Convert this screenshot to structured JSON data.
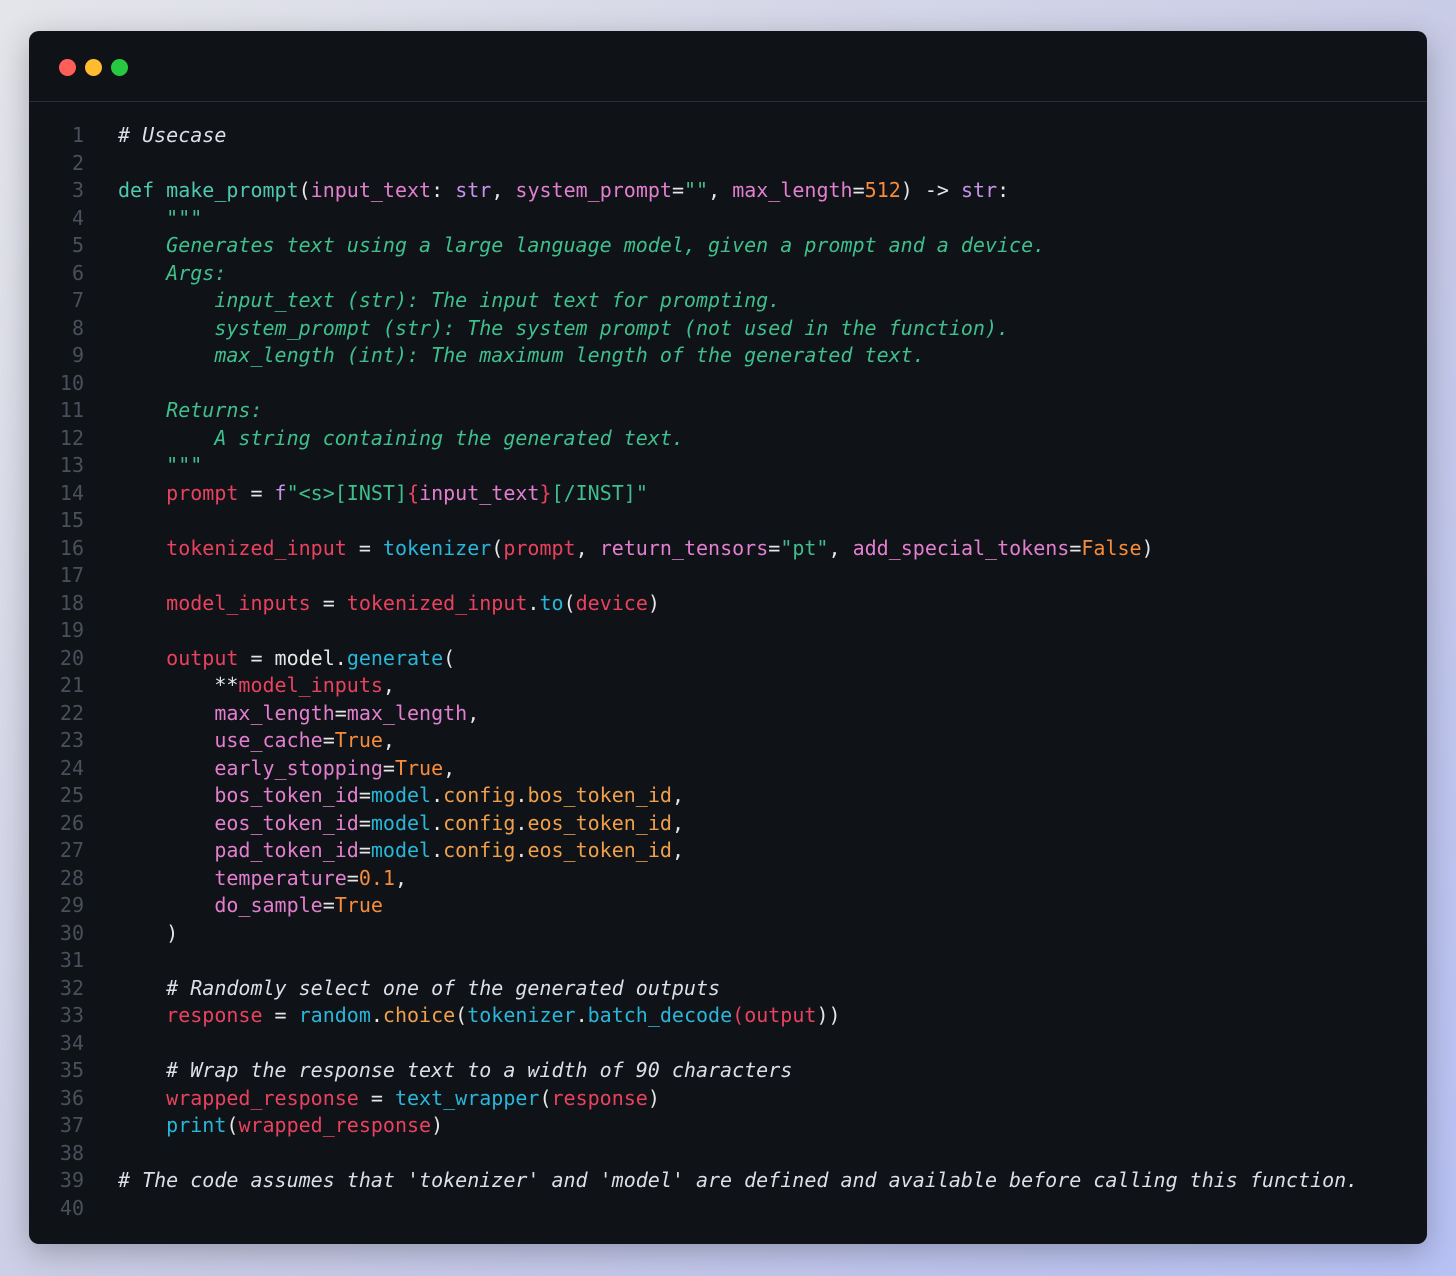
{
  "window": {
    "traffic_lights": [
      "close",
      "minimize",
      "maximize"
    ]
  },
  "code": {
    "lines": [
      {
        "n": "1",
        "tokens": [
          {
            "t": "# Usecase",
            "c": "comment"
          }
        ]
      },
      {
        "n": "2",
        "tokens": []
      },
      {
        "n": "3",
        "tokens": [
          {
            "t": "def ",
            "c": "keyword"
          },
          {
            "t": "make_prompt",
            "c": "fn"
          },
          {
            "t": "(",
            "c": "punct"
          },
          {
            "t": "input_text",
            "c": "param"
          },
          {
            "t": ": ",
            "c": "punct"
          },
          {
            "t": "str",
            "c": "type"
          },
          {
            "t": ", ",
            "c": "punct"
          },
          {
            "t": "system_prompt",
            "c": "param"
          },
          {
            "t": "=",
            "c": "punct"
          },
          {
            "t": "\"\"",
            "c": "str"
          },
          {
            "t": ", ",
            "c": "punct"
          },
          {
            "t": "max_length",
            "c": "param"
          },
          {
            "t": "=",
            "c": "punct"
          },
          {
            "t": "512",
            "c": "num"
          },
          {
            "t": ") -> ",
            "c": "punct"
          },
          {
            "t": "str",
            "c": "type"
          },
          {
            "t": ":",
            "c": "punct"
          }
        ]
      },
      {
        "n": "4",
        "tokens": [
          {
            "t": "    \"\"\"",
            "c": "doc"
          }
        ]
      },
      {
        "n": "5",
        "tokens": [
          {
            "t": "    Generates text using a large language model, given a prompt and a device.",
            "c": "doc"
          }
        ]
      },
      {
        "n": "6",
        "tokens": [
          {
            "t": "    Args:",
            "c": "doc"
          }
        ]
      },
      {
        "n": "7",
        "tokens": [
          {
            "t": "        input_text (str): The input text for prompting.",
            "c": "doc"
          }
        ]
      },
      {
        "n": "8",
        "tokens": [
          {
            "t": "        system_prompt (str): The system prompt (not used in the function).",
            "c": "doc"
          }
        ]
      },
      {
        "n": "9",
        "tokens": [
          {
            "t": "        max_length (int): The maximum length of the generated text.",
            "c": "doc"
          }
        ]
      },
      {
        "n": "10",
        "tokens": []
      },
      {
        "n": "11",
        "tokens": [
          {
            "t": "    Returns:",
            "c": "doc"
          }
        ]
      },
      {
        "n": "12",
        "tokens": [
          {
            "t": "        A string containing the generated text.",
            "c": "doc"
          }
        ]
      },
      {
        "n": "13",
        "tokens": [
          {
            "t": "    \"\"\"",
            "c": "doc"
          }
        ]
      },
      {
        "n": "14",
        "tokens": [
          {
            "t": "    ",
            "c": "plain"
          },
          {
            "t": "prompt",
            "c": "var"
          },
          {
            "t": " = ",
            "c": "op"
          },
          {
            "t": "f",
            "c": "fprefix"
          },
          {
            "t": "\"<s>[INST]",
            "c": "str"
          },
          {
            "t": "{",
            "c": "var"
          },
          {
            "t": "input_text",
            "c": "param"
          },
          {
            "t": "}",
            "c": "var"
          },
          {
            "t": "[/INST]\"",
            "c": "str"
          }
        ]
      },
      {
        "n": "15",
        "tokens": []
      },
      {
        "n": "16",
        "tokens": [
          {
            "t": "    ",
            "c": "plain"
          },
          {
            "t": "tokenized_input",
            "c": "var"
          },
          {
            "t": " = ",
            "c": "op"
          },
          {
            "t": "tokenizer",
            "c": "call"
          },
          {
            "t": "(",
            "c": "punct"
          },
          {
            "t": "prompt",
            "c": "var"
          },
          {
            "t": ", ",
            "c": "punct"
          },
          {
            "t": "return_tensors",
            "c": "param"
          },
          {
            "t": "=",
            "c": "punct"
          },
          {
            "t": "\"pt\"",
            "c": "str"
          },
          {
            "t": ", ",
            "c": "punct"
          },
          {
            "t": "add_special_tokens",
            "c": "param"
          },
          {
            "t": "=",
            "c": "punct"
          },
          {
            "t": "False",
            "c": "bool"
          },
          {
            "t": ")",
            "c": "punct"
          }
        ]
      },
      {
        "n": "17",
        "tokens": []
      },
      {
        "n": "18",
        "tokens": [
          {
            "t": "    ",
            "c": "plain"
          },
          {
            "t": "model_inputs",
            "c": "var"
          },
          {
            "t": " = ",
            "c": "op"
          },
          {
            "t": "tokenized_input",
            "c": "var"
          },
          {
            "t": ".",
            "c": "punct"
          },
          {
            "t": "to",
            "c": "call"
          },
          {
            "t": "(",
            "c": "punct"
          },
          {
            "t": "device",
            "c": "var"
          },
          {
            "t": ")",
            "c": "punct"
          }
        ]
      },
      {
        "n": "19",
        "tokens": []
      },
      {
        "n": "20",
        "tokens": [
          {
            "t": "    ",
            "c": "plain"
          },
          {
            "t": "output",
            "c": "var"
          },
          {
            "t": " = ",
            "c": "op"
          },
          {
            "t": "model",
            "c": "plain"
          },
          {
            "t": ".",
            "c": "punct"
          },
          {
            "t": "generate",
            "c": "call"
          },
          {
            "t": "(",
            "c": "punct"
          }
        ]
      },
      {
        "n": "21",
        "tokens": [
          {
            "t": "        **",
            "c": "plain"
          },
          {
            "t": "model_inputs",
            "c": "var"
          },
          {
            "t": ",",
            "c": "punct"
          }
        ]
      },
      {
        "n": "22",
        "tokens": [
          {
            "t": "        ",
            "c": "plain"
          },
          {
            "t": "max_length",
            "c": "param"
          },
          {
            "t": "=",
            "c": "punct"
          },
          {
            "t": "max_length",
            "c": "param"
          },
          {
            "t": ",",
            "c": "punct"
          }
        ]
      },
      {
        "n": "23",
        "tokens": [
          {
            "t": "        ",
            "c": "plain"
          },
          {
            "t": "use_cache",
            "c": "param"
          },
          {
            "t": "=",
            "c": "punct"
          },
          {
            "t": "True",
            "c": "bool"
          },
          {
            "t": ",",
            "c": "punct"
          }
        ]
      },
      {
        "n": "24",
        "tokens": [
          {
            "t": "        ",
            "c": "plain"
          },
          {
            "t": "early_stopping",
            "c": "param"
          },
          {
            "t": "=",
            "c": "punct"
          },
          {
            "t": "True",
            "c": "bool"
          },
          {
            "t": ",",
            "c": "punct"
          }
        ]
      },
      {
        "n": "25",
        "tokens": [
          {
            "t": "        ",
            "c": "plain"
          },
          {
            "t": "bos_token_id",
            "c": "param"
          },
          {
            "t": "=",
            "c": "punct"
          },
          {
            "t": "model",
            "c": "call"
          },
          {
            "t": ".",
            "c": "punct"
          },
          {
            "t": "config",
            "c": "attr"
          },
          {
            "t": ".",
            "c": "punct"
          },
          {
            "t": "bos_token_id",
            "c": "attr"
          },
          {
            "t": ",",
            "c": "punct"
          }
        ]
      },
      {
        "n": "26",
        "tokens": [
          {
            "t": "        ",
            "c": "plain"
          },
          {
            "t": "eos_token_id",
            "c": "param"
          },
          {
            "t": "=",
            "c": "punct"
          },
          {
            "t": "model",
            "c": "call"
          },
          {
            "t": ".",
            "c": "punct"
          },
          {
            "t": "config",
            "c": "attr"
          },
          {
            "t": ".",
            "c": "punct"
          },
          {
            "t": "eos_token_id",
            "c": "attr"
          },
          {
            "t": ",",
            "c": "punct"
          }
        ]
      },
      {
        "n": "27",
        "tokens": [
          {
            "t": "        ",
            "c": "plain"
          },
          {
            "t": "pad_token_id",
            "c": "param"
          },
          {
            "t": "=",
            "c": "punct"
          },
          {
            "t": "model",
            "c": "call"
          },
          {
            "t": ".",
            "c": "punct"
          },
          {
            "t": "config",
            "c": "attr"
          },
          {
            "t": ".",
            "c": "punct"
          },
          {
            "t": "eos_token_id",
            "c": "attr"
          },
          {
            "t": ",",
            "c": "punct"
          }
        ]
      },
      {
        "n": "28",
        "tokens": [
          {
            "t": "        ",
            "c": "plain"
          },
          {
            "t": "temperature",
            "c": "param"
          },
          {
            "t": "=",
            "c": "punct"
          },
          {
            "t": "0.1",
            "c": "num"
          },
          {
            "t": ",",
            "c": "punct"
          }
        ]
      },
      {
        "n": "29",
        "tokens": [
          {
            "t": "        ",
            "c": "plain"
          },
          {
            "t": "do_sample",
            "c": "param"
          },
          {
            "t": "=",
            "c": "punct"
          },
          {
            "t": "True",
            "c": "bool"
          }
        ]
      },
      {
        "n": "30",
        "tokens": [
          {
            "t": "    )",
            "c": "punct"
          }
        ]
      },
      {
        "n": "31",
        "tokens": []
      },
      {
        "n": "32",
        "tokens": [
          {
            "t": "    # Randomly select one of the generated outputs",
            "c": "comment"
          }
        ]
      },
      {
        "n": "33",
        "tokens": [
          {
            "t": "    ",
            "c": "plain"
          },
          {
            "t": "response",
            "c": "var"
          },
          {
            "t": " = ",
            "c": "op"
          },
          {
            "t": "random",
            "c": "call"
          },
          {
            "t": ".",
            "c": "punct"
          },
          {
            "t": "choice",
            "c": "attr"
          },
          {
            "t": "(",
            "c": "punct"
          },
          {
            "t": "tokenizer",
            "c": "call"
          },
          {
            "t": ".",
            "c": "punct"
          },
          {
            "t": "batch_decode",
            "c": "call"
          },
          {
            "t": "(",
            "c": "var"
          },
          {
            "t": "output",
            "c": "var"
          },
          {
            "t": "))",
            "c": "punct"
          }
        ]
      },
      {
        "n": "34",
        "tokens": []
      },
      {
        "n": "35",
        "tokens": [
          {
            "t": "    # Wrap the response text to a width of 90 characters",
            "c": "comment"
          }
        ]
      },
      {
        "n": "36",
        "tokens": [
          {
            "t": "    ",
            "c": "plain"
          },
          {
            "t": "wrapped_response",
            "c": "var"
          },
          {
            "t": " = ",
            "c": "op"
          },
          {
            "t": "text_wrapper",
            "c": "call"
          },
          {
            "t": "(",
            "c": "punct"
          },
          {
            "t": "response",
            "c": "var"
          },
          {
            "t": ")",
            "c": "punct"
          }
        ]
      },
      {
        "n": "37",
        "tokens": [
          {
            "t": "    ",
            "c": "plain"
          },
          {
            "t": "print",
            "c": "call"
          },
          {
            "t": "(",
            "c": "punct"
          },
          {
            "t": "wrapped_response",
            "c": "var"
          },
          {
            "t": ")",
            "c": "punct"
          }
        ]
      },
      {
        "n": "38",
        "tokens": []
      },
      {
        "n": "39",
        "tokens": [
          {
            "t": "# The code assumes that 'tokenizer' and 'model' are defined and available before calling this function.",
            "c": "comment"
          }
        ]
      },
      {
        "n": "40",
        "tokens": []
      }
    ]
  }
}
